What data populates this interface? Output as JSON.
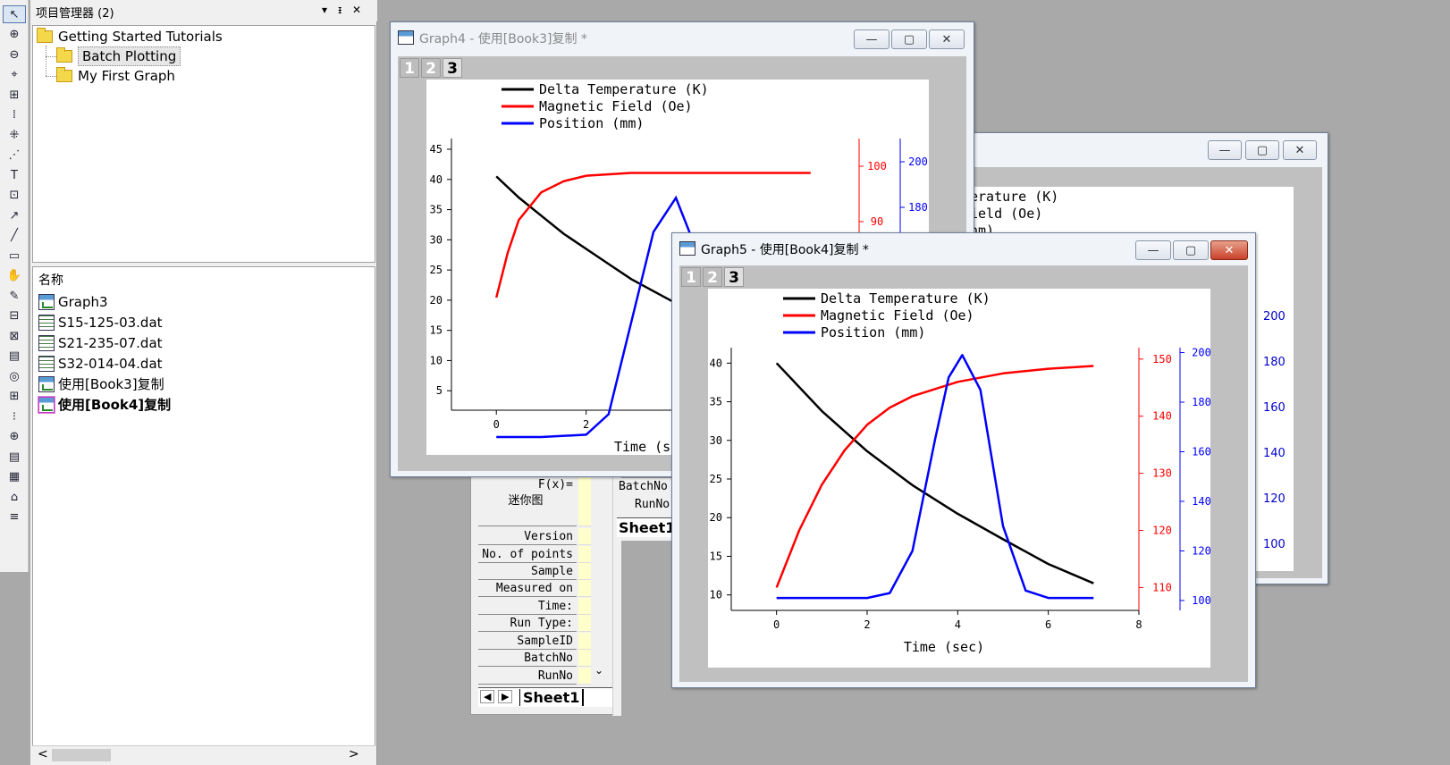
{
  "project_explorer": {
    "title": "项目管理器 (2)",
    "pin_glyph": "▾",
    "pin2_glyph": "ᵻ",
    "close_glyph": "✕",
    "folders": [
      {
        "label": "Getting Started Tutorials"
      },
      {
        "label": "Batch Plotting"
      },
      {
        "label": "My First Graph"
      }
    ],
    "list_header": "名称",
    "items": [
      {
        "label": "Graph3",
        "icon": "graph-icon"
      },
      {
        "label": "S15-125-03.dat",
        "icon": "workbook-icon"
      },
      {
        "label": "S21-235-07.dat",
        "icon": "workbook-icon"
      },
      {
        "label": "S32-014-04.dat",
        "icon": "workbook-icon"
      },
      {
        "label": "使用[Book3]复制",
        "icon": "graph-icon"
      },
      {
        "label": "使用[Book4]复制",
        "icon": "graph-icon"
      }
    ],
    "scroll_left": "<",
    "scroll_right": ">"
  },
  "toolbar": {
    "tools": [
      "pointer",
      "zoom-in",
      "zoom-out",
      "data-reader",
      "screen-reader",
      "data-selector",
      "region",
      "mask",
      "text",
      "add-table",
      "arrow",
      "line",
      "rectangle",
      "hand",
      "hand-draw",
      "insert-graph",
      "freehand",
      "layer",
      "scale-in",
      "scale-out",
      "data-info",
      "annotate",
      "sticky",
      "table",
      "zoom-window",
      "settings"
    ]
  },
  "window_buttons": {
    "min": "—",
    "max": "▢",
    "close": "✕"
  },
  "graph4": {
    "title": "Graph4 - 使用[Book3]复制 *",
    "layers": [
      "1",
      "2",
      "3"
    ],
    "legend": [
      "Delta Temperature (K)",
      "Magnetic Field (Oe)",
      "Position (mm)"
    ],
    "xlabel": "Time (sec)",
    "y_ticks": [
      "45",
      "40",
      "35",
      "30",
      "25",
      "20",
      "15",
      "10",
      "5"
    ],
    "x_ticks": [
      "0",
      "2",
      "4"
    ],
    "y2_ticks": [
      "100",
      "90"
    ],
    "y3_ticks": [
      "200",
      "180"
    ]
  },
  "graph_back": {
    "y_ticks": [
      "200",
      "180",
      "160",
      "140",
      "120",
      "100"
    ],
    "legend_fragment": [
      "erature (K)",
      "ield (Oe)",
      "nm)"
    ]
  },
  "graph5": {
    "title": "Graph5 - 使用[Book4]复制 *",
    "layers": [
      "1",
      "2",
      "3"
    ],
    "legend": [
      "Delta Temperature (K)",
      "Magnetic Field (Oe)",
      "Position (mm)"
    ],
    "xlabel": "Time (sec)",
    "y_ticks": [
      "40",
      "35",
      "30",
      "25",
      "20",
      "15",
      "10"
    ],
    "x_ticks": [
      "0",
      "2",
      "4",
      "6",
      "8"
    ],
    "y2_ticks": [
      "150",
      "140",
      "130",
      "120",
      "110"
    ],
    "y3_ticks": [
      "200",
      "180",
      "160",
      "140",
      "120",
      "100"
    ]
  },
  "worksheet": {
    "rows": [
      "F(x)=",
      "迷你图",
      "Version",
      "No. of points",
      "Sample",
      "Measured on",
      "Time:",
      "Run Type:",
      "SampleID",
      "BatchNo",
      "RunNo"
    ],
    "sheet_tab": "Sheet1",
    "other_labels": [
      "BatchNo",
      "RunNo",
      "Sheet1"
    ]
  },
  "colors": {
    "temperature": "#000000",
    "field": "#ff0000",
    "position": "#0000ff"
  },
  "chart_data": [
    {
      "type": "line",
      "title": "Graph4",
      "xlabel": "Time (sec)",
      "series": [
        {
          "name": "Delta Temperature (K)",
          "x": [
            0,
            0.5,
            1,
            1.5,
            2,
            2.5,
            3,
            3.5,
            4,
            4.5,
            5
          ],
          "values": [
            40.5,
            37,
            34,
            31,
            28.5,
            26,
            23.5,
            21.5,
            19.5,
            17.5,
            15.5
          ]
        },
        {
          "name": "Magnetic Field (Oe)",
          "x": [
            0,
            0.25,
            0.5,
            1,
            1.5,
            2,
            3,
            4,
            5,
            6,
            7
          ],
          "values": [
            80,
            88,
            94,
            99,
            101,
            102,
            102.5,
            102.5,
            102.5,
            102.5,
            102.5
          ]
        },
        {
          "name": "Position (mm)",
          "x": [
            0,
            1,
            2,
            2.5,
            3,
            3.5,
            4,
            4.5,
            5,
            5.5
          ],
          "values": [
            100,
            100,
            101,
            110,
            150,
            190,
            205,
            180,
            110,
            100
          ]
        }
      ],
      "xlim": [
        -1,
        8
      ],
      "ylim": [
        0,
        45
      ]
    },
    {
      "type": "line",
      "title": "Graph5",
      "xlabel": "Time (sec)",
      "series": [
        {
          "name": "Delta Temperature (K)",
          "x": [
            0,
            1,
            2,
            3,
            4,
            5,
            6,
            7
          ],
          "values": [
            40,
            33.8,
            28.6,
            24.2,
            20.5,
            17.2,
            14,
            11.5
          ]
        },
        {
          "name": "Magnetic Field (Oe)",
          "x": [
            0,
            0.5,
            1,
            1.5,
            2,
            2.5,
            3,
            4,
            5,
            6,
            7
          ],
          "values": [
            110,
            120,
            128,
            134,
            138.5,
            141.5,
            143.5,
            146,
            147.5,
            148.3,
            148.8
          ]
        },
        {
          "name": "Position (mm)",
          "x": [
            0,
            1,
            2,
            2.5,
            3,
            3.5,
            3.8,
            4.1,
            4.5,
            5,
            5.5,
            6,
            7
          ],
          "values": [
            101,
            101,
            101,
            103,
            120,
            165,
            190,
            199,
            185,
            130,
            104,
            101,
            101
          ]
        }
      ],
      "xlim": [
        -1,
        8
      ],
      "ylim": [
        8,
        42
      ],
      "y2lim": [
        106,
        152
      ],
      "y3lim": [
        96,
        202
      ]
    }
  ]
}
